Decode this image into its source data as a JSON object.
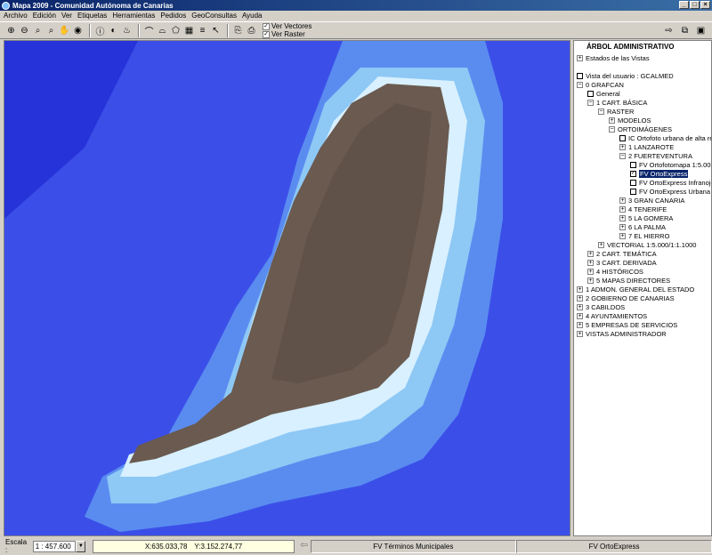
{
  "window": {
    "title": "Mapa 2009 - Comunidad Autónoma de Canarias"
  },
  "menu": [
    "Archivo",
    "Edición",
    "Ver",
    "Etiquetas",
    "Herramientas",
    "Pedidos",
    "GeoConsultas",
    "Ayuda"
  ],
  "toolbar": {
    "icons": [
      "zoom-in-icon",
      "zoom-out-icon",
      "zoom-window-icon",
      "zoom-previous-icon",
      "pan-hand-icon",
      "globe-icon",
      "info-icon",
      "measure-icon",
      "fire-icon",
      "profile-icon",
      "area-icon",
      "polygon-icon",
      "grid-icon",
      "select-icon",
      "copy-icon",
      "print-icon"
    ],
    "ver_vectores": "Ver Vectores",
    "ver_raster": "Ver Raster",
    "ver_vectores_checked": true,
    "ver_raster_checked": true
  },
  "panel": {
    "title": "ÁRBOL ADMINISTRATIVO",
    "estados": "Estados de las Vistas",
    "tree": [
      {
        "label": "Vista del usuario : GCALMED",
        "level": 0,
        "kind": "leaf"
      },
      {
        "label": "0 GRAFCAN",
        "level": 0,
        "kind": "minus"
      },
      {
        "label": "General",
        "level": 1,
        "kind": "leaf"
      },
      {
        "label": "1 CART. BÁSICA",
        "level": 1,
        "kind": "minus"
      },
      {
        "label": "RASTER",
        "level": 2,
        "kind": "minus"
      },
      {
        "label": "MODELOS",
        "level": 3,
        "kind": "plus"
      },
      {
        "label": "ORTOIMÁGENES",
        "level": 3,
        "kind": "minus"
      },
      {
        "label": "IC Ortofoto urbana de alta resol",
        "level": 4,
        "kind": "leaf"
      },
      {
        "label": "1 LANZAROTE",
        "level": 4,
        "kind": "plus"
      },
      {
        "label": "2 FUERTEVENTURA",
        "level": 4,
        "kind": "minus"
      },
      {
        "label": "FV Ortofotomapa 1:5.000/1",
        "level": 5,
        "kind": "leaf"
      },
      {
        "label": "FV OrtoExpress",
        "level": 5,
        "kind": "checked",
        "selected": true
      },
      {
        "label": "FV OrtoExpress Infranojo",
        "level": 5,
        "kind": "leaf"
      },
      {
        "label": "FV OrtoExpress Urbana (alt",
        "level": 5,
        "kind": "leaf"
      },
      {
        "label": "3 GRAN CANARIA",
        "level": 4,
        "kind": "plus"
      },
      {
        "label": "4 TENERIFE",
        "level": 4,
        "kind": "plus"
      },
      {
        "label": "5 LA GOMERA",
        "level": 4,
        "kind": "plus"
      },
      {
        "label": "6 LA PALMA",
        "level": 4,
        "kind": "plus"
      },
      {
        "label": "7 EL HIERRO",
        "level": 4,
        "kind": "plus"
      },
      {
        "label": "VECTORIAL 1:5.000/1:1.1000",
        "level": 2,
        "kind": "plus"
      },
      {
        "label": "2 CART. TEMÁTICA",
        "level": 1,
        "kind": "plus"
      },
      {
        "label": "3 CART. DERIVADA",
        "level": 1,
        "kind": "plus"
      },
      {
        "label": "4 HISTÓRICOS",
        "level": 1,
        "kind": "plus"
      },
      {
        "label": "5 MAPAS DIRECTORES",
        "level": 1,
        "kind": "plus"
      },
      {
        "label": "1 ADMON. GENERAL DEL ESTADO",
        "level": 0,
        "kind": "plus"
      },
      {
        "label": "2 GOBIERNO DE CANARIAS",
        "level": 0,
        "kind": "plus"
      },
      {
        "label": "3 CABILDOS",
        "level": 0,
        "kind": "plus"
      },
      {
        "label": "4 AYUNTAMIENTOS",
        "level": 0,
        "kind": "plus"
      },
      {
        "label": "5 EMPRESAS DE SERVICIOS",
        "level": 0,
        "kind": "plus"
      },
      {
        "label": "VISTAS ADMINISTRADOR",
        "level": 0,
        "kind": "plus"
      }
    ]
  },
  "status": {
    "escala_label": "Escala :",
    "escala_value": "1 : 457.600",
    "x": "X:635.033,78",
    "y": "Y:3.152.274,77",
    "layer1": "FV Términos Municipales",
    "layer2": "FV OrtoExpress"
  },
  "colors": {
    "deep_sea": "#2633d8",
    "sea": "#3b4fe8",
    "shelf": "#5a8cf0",
    "shallow": "#8ec8f5",
    "coast": "#d8f0ff",
    "land": "#6a5a50"
  }
}
